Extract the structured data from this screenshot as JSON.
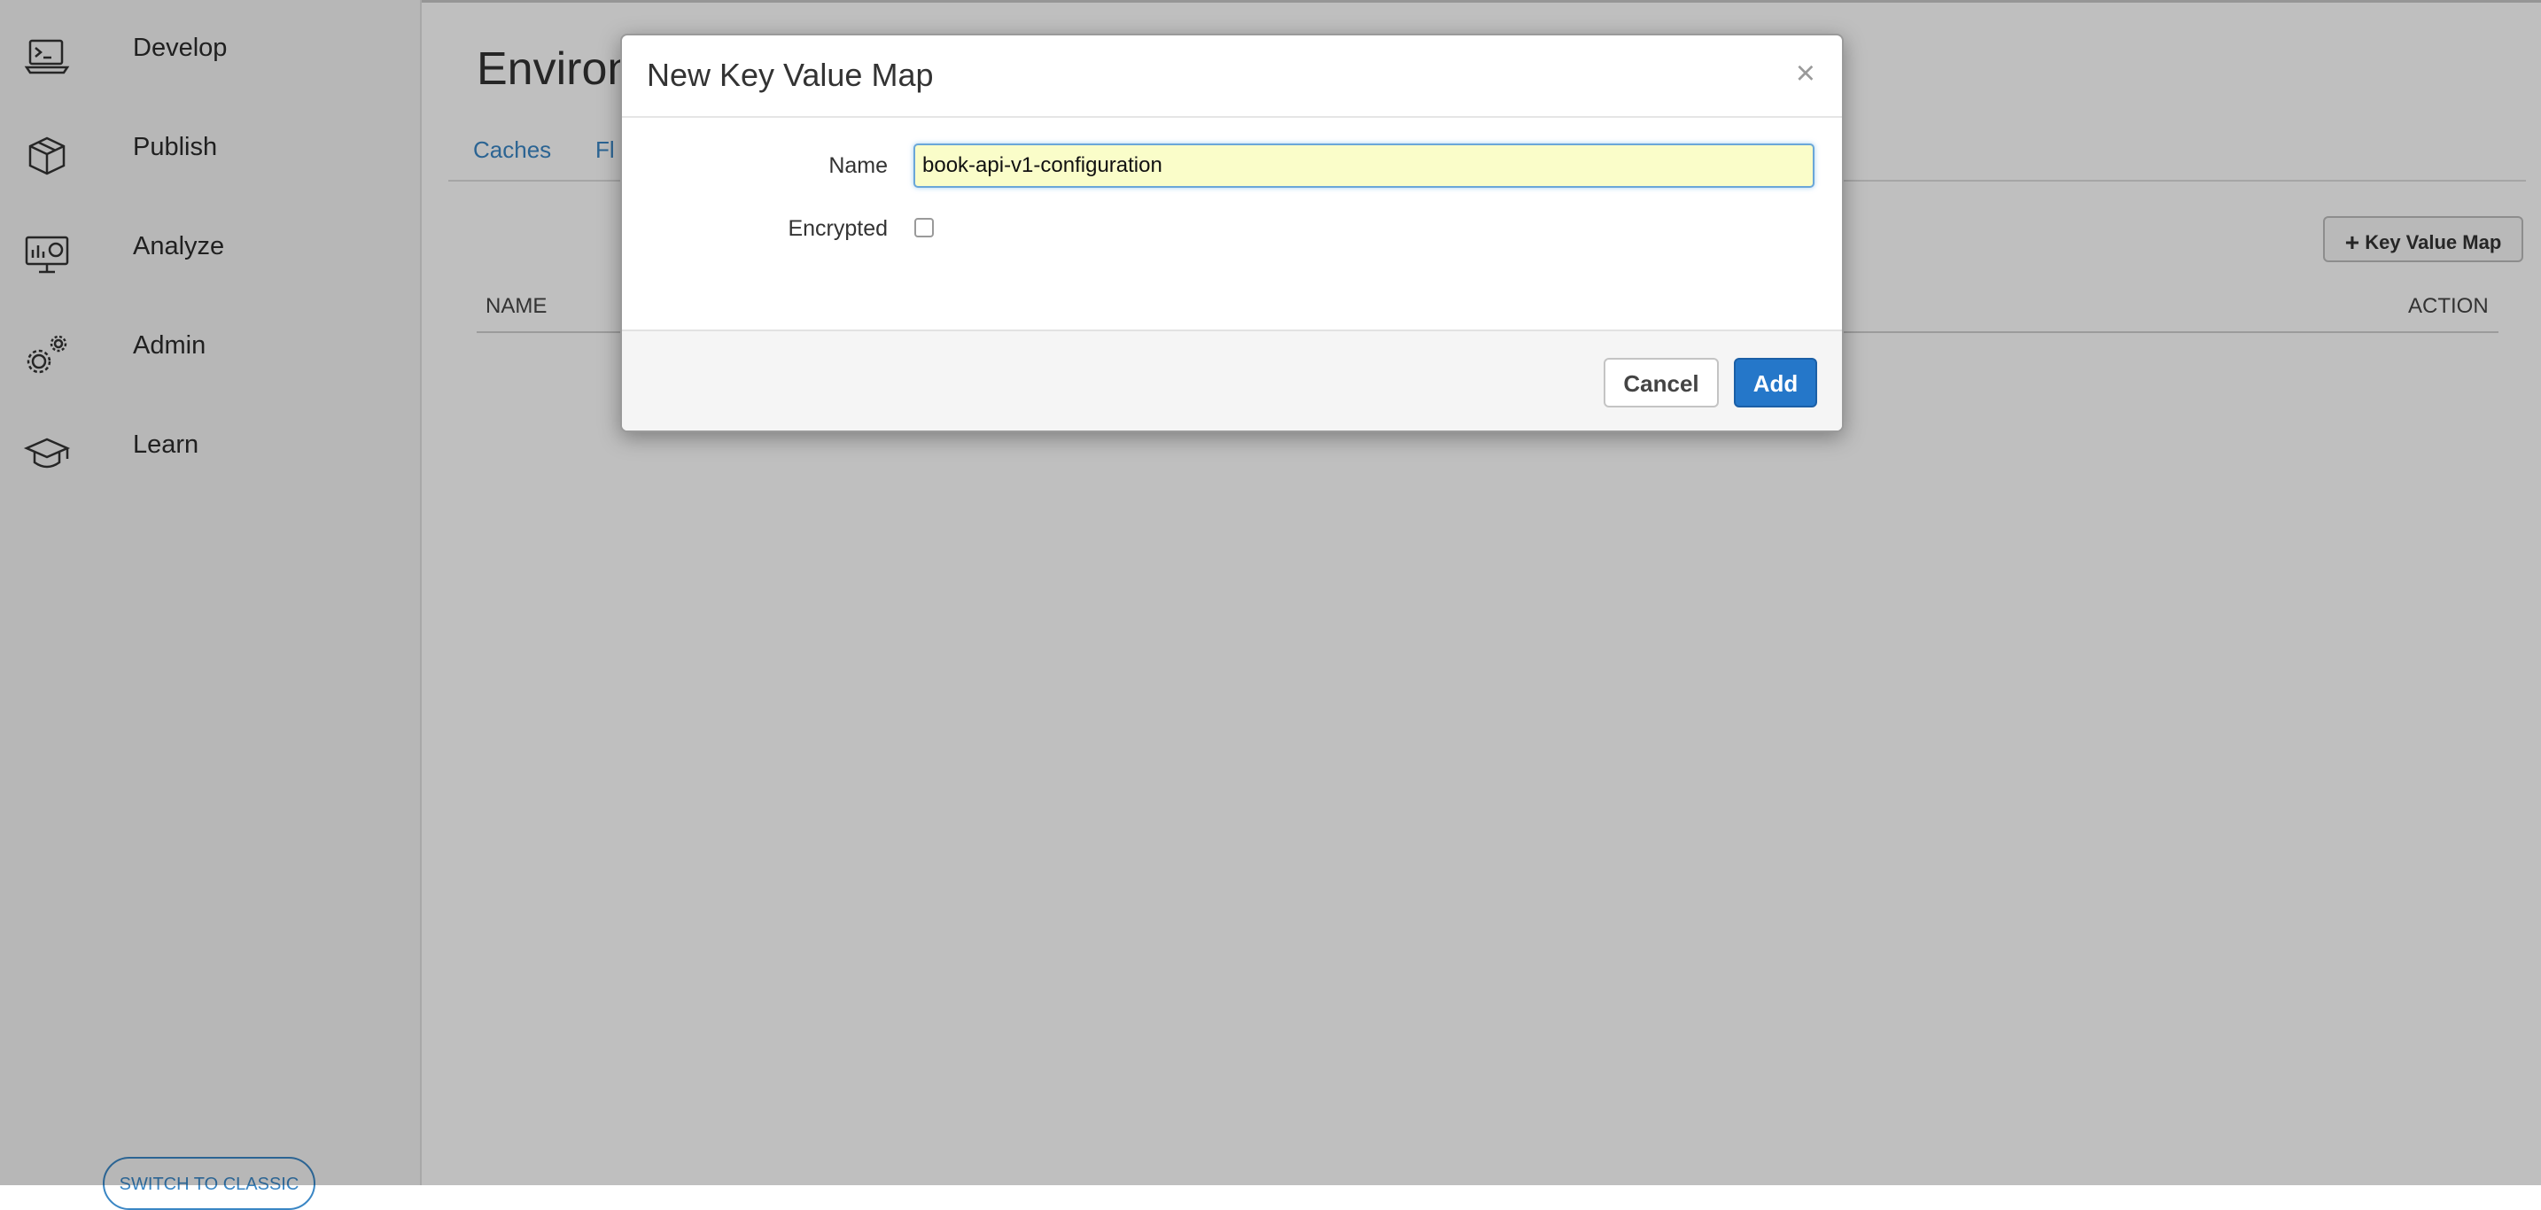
{
  "sidebar": {
    "items": [
      {
        "label": "Develop",
        "icon": "terminal-laptop-icon"
      },
      {
        "label": "Publish",
        "icon": "package-box-icon"
      },
      {
        "label": "Analyze",
        "icon": "monitor-chart-icon"
      },
      {
        "label": "Admin",
        "icon": "gears-icon"
      },
      {
        "label": "Learn",
        "icon": "graduation-cap-icon"
      }
    ],
    "switch_label": "SWITCH TO CLASSIC"
  },
  "main": {
    "title": "Environ",
    "tabs": [
      {
        "label": "Caches"
      },
      {
        "label": "Fl"
      }
    ],
    "add_kvm_label": "Key Value Map",
    "columns": {
      "name": "NAME",
      "action": "ACTION"
    }
  },
  "modal": {
    "title": "New Key Value Map",
    "close_glyph": "×",
    "name_label": "Name",
    "name_value": "book-api-v1-configuration",
    "encrypted_label": "Encrypted",
    "encrypted_checked": false,
    "cancel_label": "Cancel",
    "add_label": "Add"
  },
  "colors": {
    "accent": "#2577c9",
    "link": "#3a86c4",
    "input_highlight": "#fafdc9"
  }
}
